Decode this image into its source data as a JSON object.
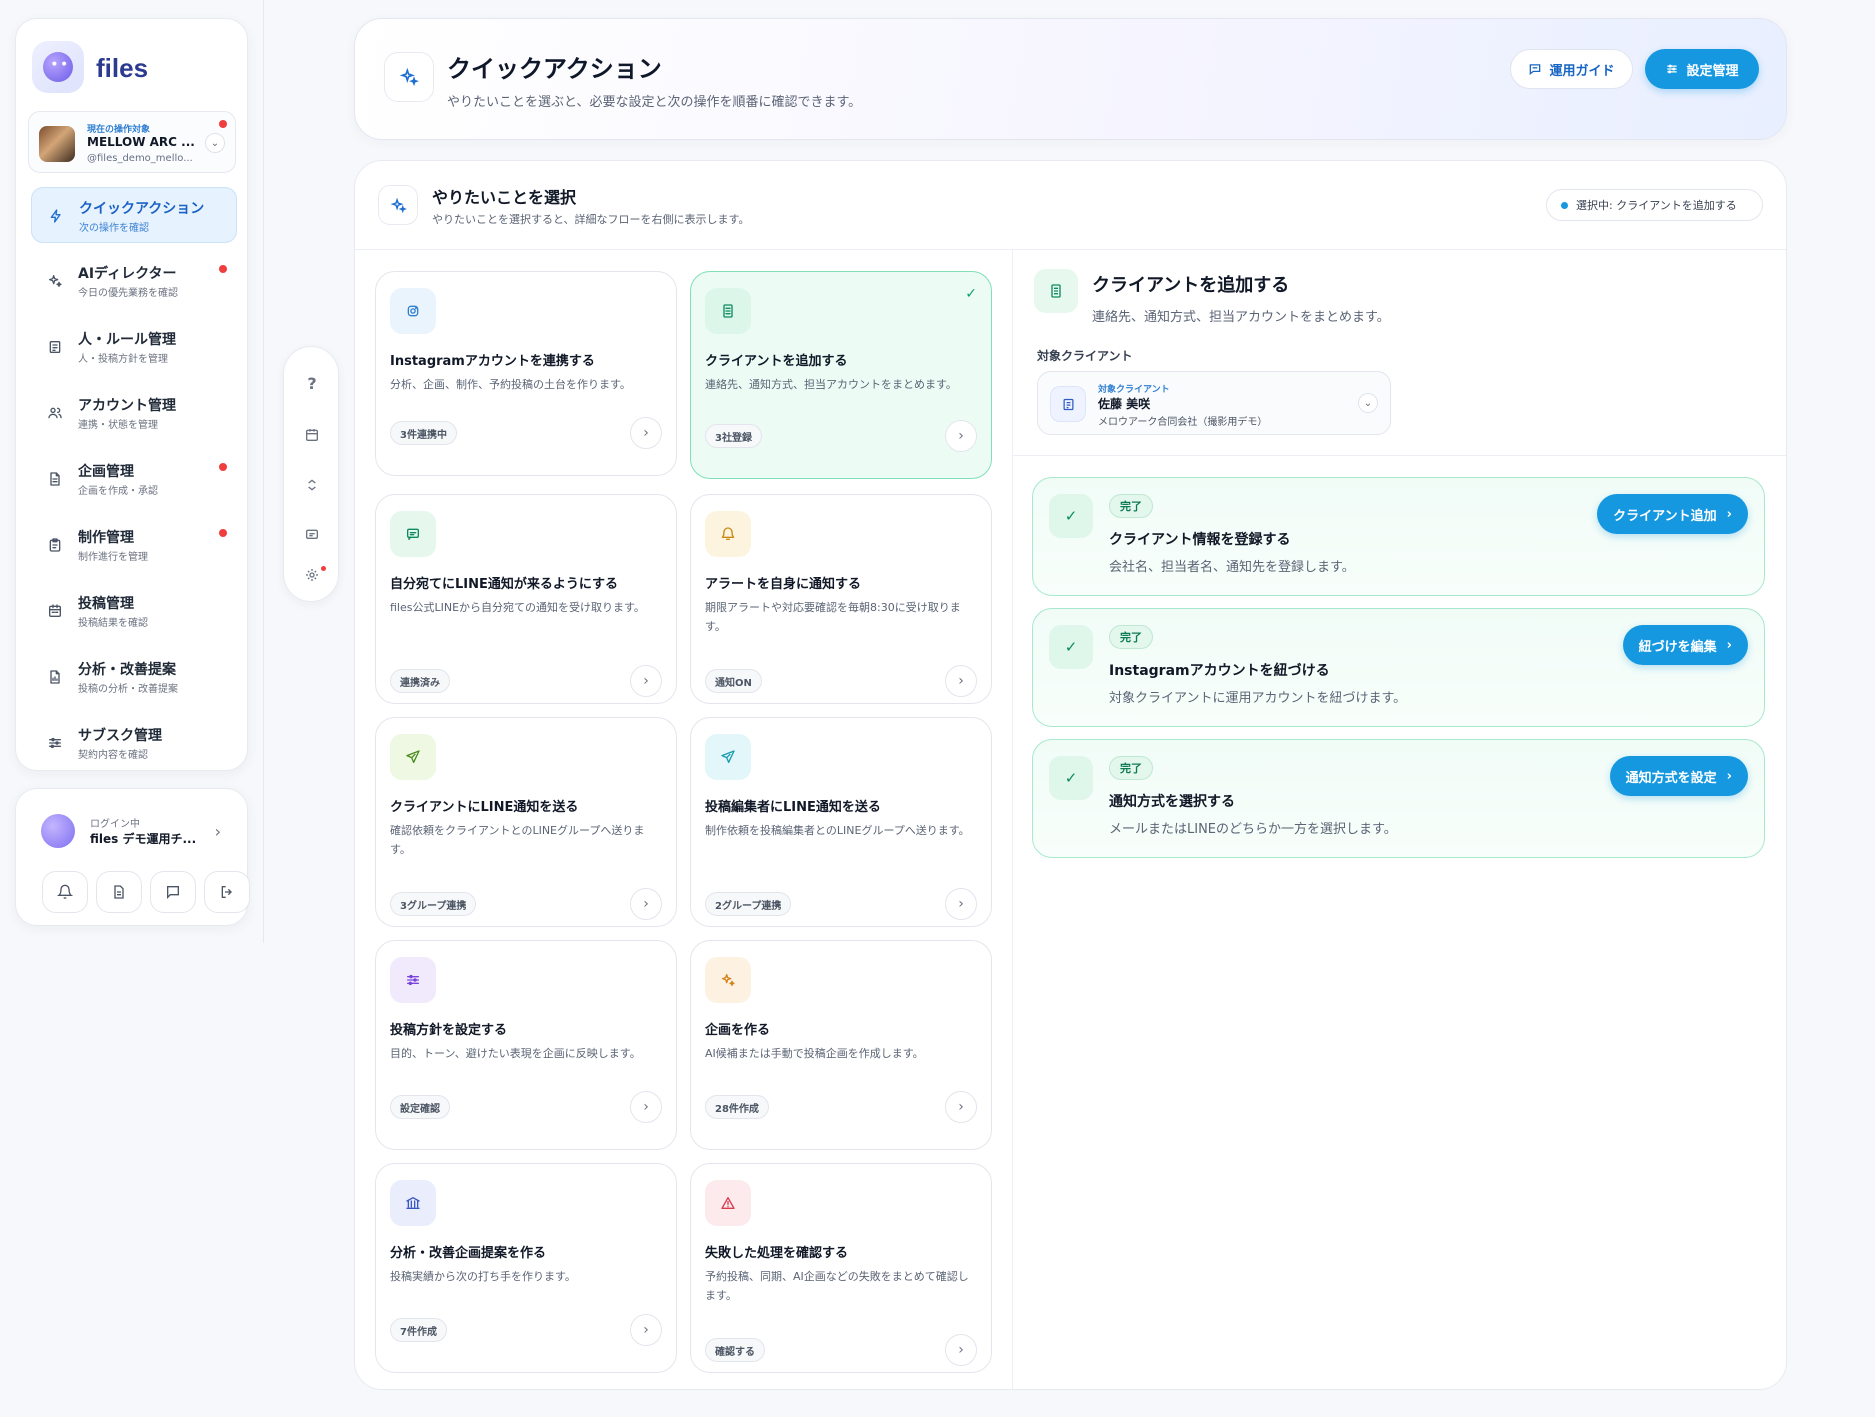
{
  "brand": "files",
  "client": {
    "caption": "現在の操作対象",
    "name": "MELLOW ARC ...",
    "handle": "@files_demo_mello..."
  },
  "nav": [
    {
      "label": "クイックアクション",
      "sub": "次の操作を確認",
      "icon": "bolt-icon",
      "active": true,
      "alert": false
    },
    {
      "label": "AIディレクター",
      "sub": "今日の優先業務を確認",
      "icon": "sparkle-icon",
      "active": false,
      "alert": true
    },
    {
      "label": "人・ルール管理",
      "sub": "人・投稿方針を管理",
      "icon": "document-icon",
      "active": false,
      "alert": false
    },
    {
      "label": "アカウント管理",
      "sub": "連携・状態を管理",
      "icon": "users-icon",
      "active": false,
      "alert": false
    },
    {
      "label": "企画管理",
      "sub": "企画を作成・承認",
      "icon": "file-icon",
      "active": false,
      "alert": true
    },
    {
      "label": "制作管理",
      "sub": "制作進行を管理",
      "icon": "clipboard-icon",
      "active": false,
      "alert": true
    },
    {
      "label": "投稿管理",
      "sub": "投稿結果を確認",
      "icon": "calendar-icon",
      "active": false,
      "alert": false
    },
    {
      "label": "分析・改善提案",
      "sub": "投稿の分析・改善提案",
      "icon": "report-icon",
      "active": false,
      "alert": false
    },
    {
      "label": "サブスク管理",
      "sub": "契約内容を確認",
      "icon": "sliders-icon",
      "active": false,
      "alert": false
    }
  ],
  "login": {
    "caption": "ログイン中",
    "name": "files デモ運用チ..."
  },
  "header": {
    "title": "クイックアクション",
    "subtitle": "やりたいことを選ぶと、必要な設定と次の操作を順番に確認できます。",
    "guide_label": "運用ガイド",
    "settings_label": "設定管理"
  },
  "section": {
    "title": "やりたいことを選択",
    "subtitle": "やりたいことを選択すると、詳細なフローを右側に表示します。",
    "selected_pill": "選択中: クライアントを追加する"
  },
  "cards": [
    {
      "title": "Instagramアカウントを連携する",
      "desc": "分析、企画、制作、予約投稿の土台を作ります。",
      "badge": "3件連携中",
      "icon": "instagram-icon",
      "color": "#2f7fd1",
      "bg": "#eaf4fd"
    },
    {
      "title": "クライアントを追加する",
      "desc": "連絡先、通知方式、担当アカウントをまとめます。",
      "badge": "3社登録",
      "icon": "building-icon",
      "color": "#0e8a5f",
      "bg": "#dcf6e9",
      "selected": true
    },
    {
      "title": "自分宛てにLINE通知が来るようにする",
      "desc": "files公式LINEから自分宛ての通知を受け取ります。",
      "badge": "連携済み",
      "icon": "chat-icon",
      "color": "#0e8a5f",
      "bg": "#e6f8ee"
    },
    {
      "title": "アラートを自身に通知する",
      "desc": "期限アラートや対応要確認を毎朝8:30に受け取ります。",
      "badge": "通知ON",
      "icon": "bell-icon",
      "color": "#c98a16",
      "bg": "#fdf4e0"
    },
    {
      "title": "クライアントにLINE通知を送る",
      "desc": "確認依頼をクライアントとのLINEグループへ送ります。",
      "badge": "3グループ連携",
      "icon": "send-icon",
      "color": "#4b8a1e",
      "bg": "#eef8e2"
    },
    {
      "title": "投稿編集者にLINE通知を送る",
      "desc": "制作依頼を投稿編集者とのLINEグループへ送ります。",
      "badge": "2グループ連携",
      "icon": "send-icon",
      "color": "#1a9bb0",
      "bg": "#e3f6f9"
    },
    {
      "title": "投稿方針を設定する",
      "desc": "目的、トーン、避けたい表現を企画に反映します。",
      "badge": "設定確認",
      "icon": "sliders-icon",
      "color": "#7b43d9",
      "bg": "#f1eafd"
    },
    {
      "title": "企画を作る",
      "desc": "AI候補または手動で投稿企画を作成します。",
      "badge": "28件作成",
      "icon": "sparkle-icon",
      "color": "#d3801a",
      "bg": "#fdf2e2"
    },
    {
      "title": "分析・改善企画提案を作る",
      "desc": "投稿実績から次の打ち手を作ります。",
      "badge": "7件作成",
      "icon": "bank-icon",
      "color": "#3b56c4",
      "bg": "#eaeefc"
    },
    {
      "title": "失敗した処理を確認する",
      "desc": "予約投稿、同期、AI企画などの失敗をまとめて確認します。",
      "badge": "確認する",
      "icon": "warning-icon",
      "color": "#d93b4e",
      "bg": "#fdeaec"
    }
  ],
  "detail": {
    "title": "クライアントを追加する",
    "subtitle": "連絡先、通知方式、担当アカウントをまとめます。",
    "target_label": "対象クライアント",
    "target_caption": "対象クライアント",
    "target_name": "佐藤 美咲",
    "target_company": "メロウアーク合同会社（撮影用デモ）",
    "steps": [
      {
        "badge": "完了",
        "title": "クライアント情報を登録する",
        "desc": "会社名、担当者名、通知先を登録します。",
        "button": "クライアント追加"
      },
      {
        "badge": "完了",
        "title": "Instagramアカウントを紐づける",
        "desc": "対象クライアントに運用アカウントを紐づけます。",
        "button": "紐づけを編集"
      },
      {
        "badge": "完了",
        "title": "通知方式を選択する",
        "desc": "メールまたはLINEのどちらか一方を選択します。",
        "button": "通知方式を設定"
      }
    ]
  }
}
